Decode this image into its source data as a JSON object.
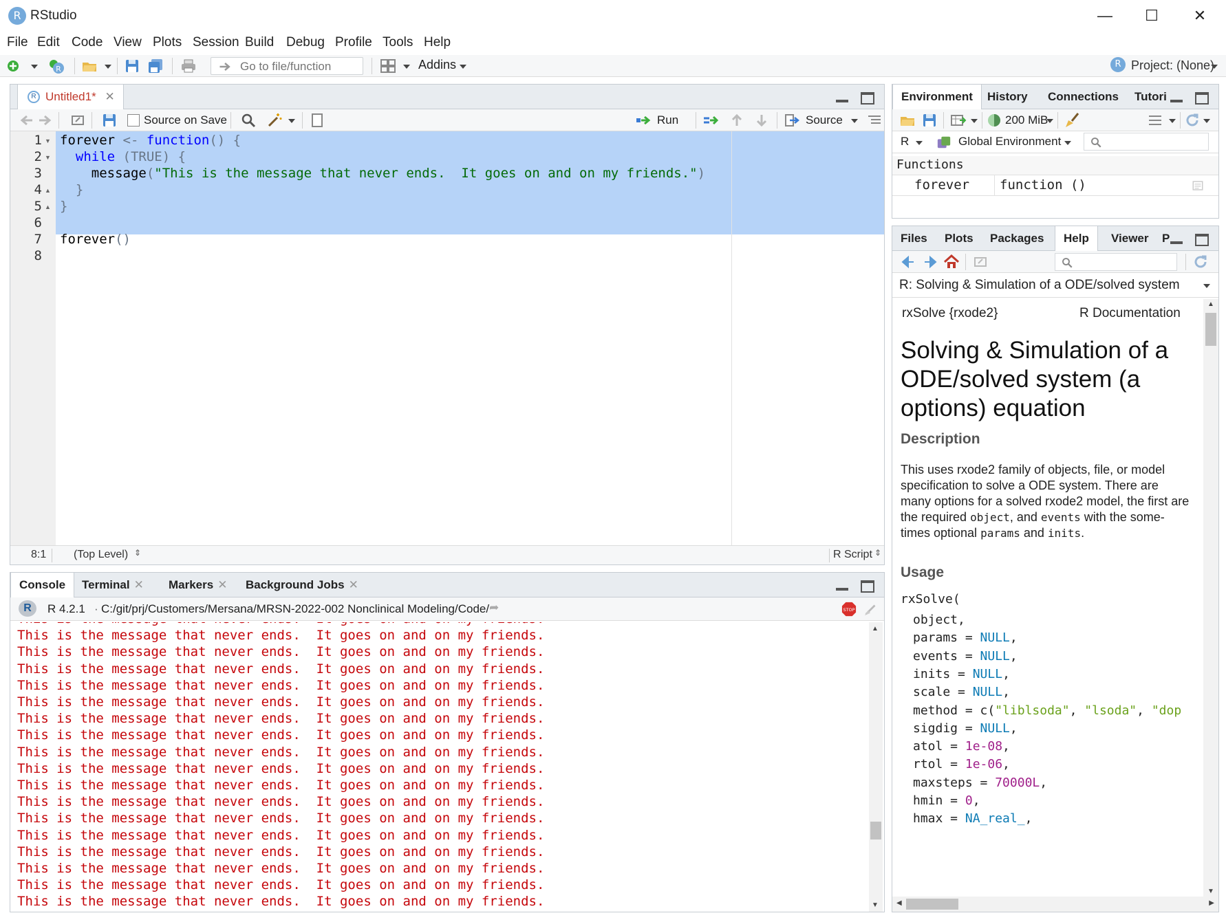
{
  "window": {
    "title": "RStudio",
    "logo_letter": "R",
    "controls": [
      "—",
      "☐",
      "✕"
    ]
  },
  "menu": [
    "File",
    "Edit",
    "Code",
    "View",
    "Plots",
    "Session",
    "Build",
    "Debug",
    "Profile",
    "Tools",
    "Help"
  ],
  "toolbar": {
    "goto_placeholder": "Go to file/function",
    "addins_label": "Addins",
    "project_label": "Project: (None)"
  },
  "editor": {
    "tab_label": "Untitled1*",
    "source_on_save_label": "Source on Save",
    "run_label": "Run",
    "source_label": "Source",
    "line_numbers": [
      "1",
      "2",
      "3",
      "4",
      "5",
      "6",
      "7",
      "8"
    ],
    "lines": [
      [
        [
          "txt",
          "forever "
        ],
        [
          "op",
          "<- "
        ],
        [
          "kw",
          "function"
        ],
        [
          "op",
          "() {"
        ]
      ],
      [
        [
          "op",
          "  "
        ],
        [
          "kw",
          "while "
        ],
        [
          "op",
          "(TRUE) {"
        ]
      ],
      [
        [
          "txt",
          "    message"
        ],
        [
          "op",
          "("
        ],
        [
          "str",
          "\"This is the message that never ends.  It goes on and on my friends.\""
        ],
        [
          "op",
          ")"
        ]
      ],
      [
        [
          "op",
          "  }"
        ]
      ],
      [
        [
          "op",
          "}"
        ]
      ],
      [],
      [
        [
          "txt",
          "forever"
        ],
        [
          "op",
          "()"
        ]
      ],
      []
    ],
    "cursor_pos": "8:1",
    "scope": "(Top Level)",
    "file_type": "R Script"
  },
  "console": {
    "tabs": [
      "Console",
      "Terminal",
      "Markers",
      "Background Jobs"
    ],
    "r_version": "R 4.2.1",
    "path": "C:/git/prj/Customers/Mersana/MRSN-2022-002 Nonclinical Modeling/Code/",
    "message": "This is the message that never ends.  It goes on and on my friends.",
    "line_count": 18
  },
  "environment": {
    "tabs": [
      "Environment",
      "History",
      "Connections",
      "Tutori"
    ],
    "memory": "200 MiB",
    "lang": "R",
    "scope": "Global Environment",
    "section": "Functions",
    "rows": [
      {
        "name": "forever",
        "value": "function ()"
      }
    ]
  },
  "help": {
    "tabs": [
      "Files",
      "Plots",
      "Packages",
      "Help",
      "Viewer",
      "P"
    ],
    "topic": "R: Solving & Simulation of a ODE/solved system",
    "header_left": "rxSolve {rxode2}",
    "header_right": "R Documentation",
    "title": "Solving & Simulation of a ODE/solved system (a options) equation",
    "desc_heading": "Description",
    "desc_parts": [
      [
        "text",
        "This uses rxode2 family of objects, file, or model specification to solve a ODE system. There are many options for a solved rxode2 model, the first are the required "
      ],
      [
        "code",
        "object"
      ],
      [
        "text",
        ", and "
      ],
      [
        "code",
        "events"
      ],
      [
        "text",
        " with the some-times optional "
      ],
      [
        "code",
        "params"
      ],
      [
        "text",
        " and "
      ],
      [
        "code",
        "inits"
      ],
      [
        "text",
        "."
      ]
    ],
    "usage_heading": "Usage",
    "usage_first": "rxSolve(",
    "usage_lines": [
      [
        [
          "p",
          "object,"
        ]
      ],
      [
        [
          "p",
          "params = "
        ],
        [
          "v",
          "NULL"
        ],
        [
          "p",
          ","
        ]
      ],
      [
        [
          "p",
          "events = "
        ],
        [
          "v",
          "NULL"
        ],
        [
          "p",
          ","
        ]
      ],
      [
        [
          "p",
          "inits = "
        ],
        [
          "v",
          "NULL"
        ],
        [
          "p",
          ","
        ]
      ],
      [
        [
          "p",
          "scale = "
        ],
        [
          "v",
          "NULL"
        ],
        [
          "p",
          ","
        ]
      ],
      [
        [
          "p",
          "method = c("
        ],
        [
          "s",
          "\"liblsoda\""
        ],
        [
          "p",
          ", "
        ],
        [
          "s",
          "\"lsoda\""
        ],
        [
          "p",
          ", "
        ],
        [
          "s",
          "\"dop"
        ]
      ],
      [
        [
          "p",
          "sigdig = "
        ],
        [
          "v",
          "NULL"
        ],
        [
          "p",
          ","
        ]
      ],
      [
        [
          "p",
          "atol = "
        ],
        [
          "n",
          "1e-08"
        ],
        [
          "p",
          ","
        ]
      ],
      [
        [
          "p",
          "rtol = "
        ],
        [
          "n",
          "1e-06"
        ],
        [
          "p",
          ","
        ]
      ],
      [
        [
          "p",
          "maxsteps = "
        ],
        [
          "n",
          "70000L"
        ],
        [
          "p",
          ","
        ]
      ],
      [
        [
          "p",
          "hmin = "
        ],
        [
          "n",
          "0"
        ],
        [
          "p",
          ","
        ]
      ],
      [
        [
          "p",
          "hmax = "
        ],
        [
          "v",
          "NA_real_"
        ],
        [
          "p",
          ","
        ]
      ]
    ]
  }
}
